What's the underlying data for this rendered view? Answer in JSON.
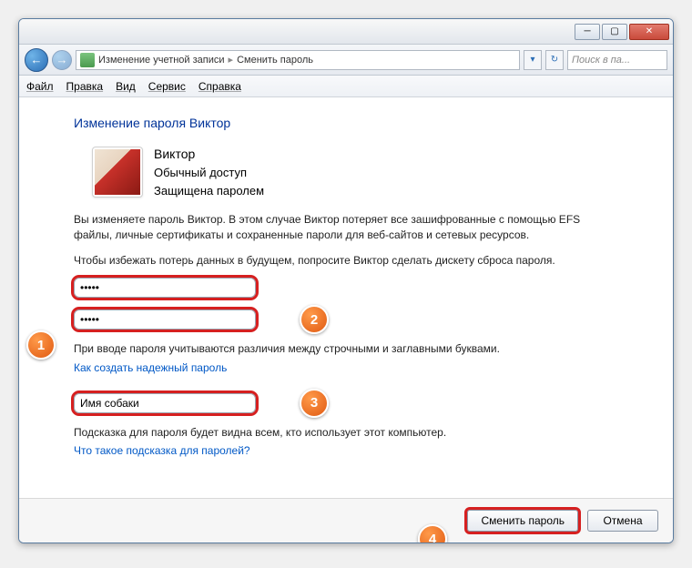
{
  "titlebar": {},
  "breadcrumb": {
    "item1": "Изменение учетной записи",
    "item2": "Сменить пароль"
  },
  "search": {
    "placeholder": "Поиск в па..."
  },
  "menu": {
    "file": "Файл",
    "edit": "Правка",
    "view": "Вид",
    "tools": "Сервис",
    "help": "Справка"
  },
  "page": {
    "title": "Изменение пароля Виктор"
  },
  "user": {
    "name": "Виктор",
    "access": "Обычный доступ",
    "protected": "Защищена паролем"
  },
  "text": {
    "warn": "Вы изменяете пароль Виктор. В этом случае Виктор потеряет все зашифрованные с помощью EFS файлы, личные сертификаты и сохраненные пароли для веб-сайтов и сетевых ресурсов.",
    "diskette": "Чтобы избежать потерь данных в будущем, попросите Виктор сделать дискету сброса пароля.",
    "caseNote": "При вводе пароля учитываются различия между строчными и заглавными буквами.",
    "hintNote": "Подсказка для пароля будет видна всем, кто использует этот компьютер."
  },
  "inputs": {
    "newPassword": "•••••",
    "confirmPassword": "•••••",
    "hint": "Имя собаки"
  },
  "links": {
    "strongPw": "Как создать надежный пароль",
    "whatHint": "Что такое подсказка для паролей?"
  },
  "buttons": {
    "change": "Сменить пароль",
    "cancel": "Отмена"
  },
  "markers": {
    "m1": "1",
    "m2": "2",
    "m3": "3",
    "m4": "4"
  }
}
